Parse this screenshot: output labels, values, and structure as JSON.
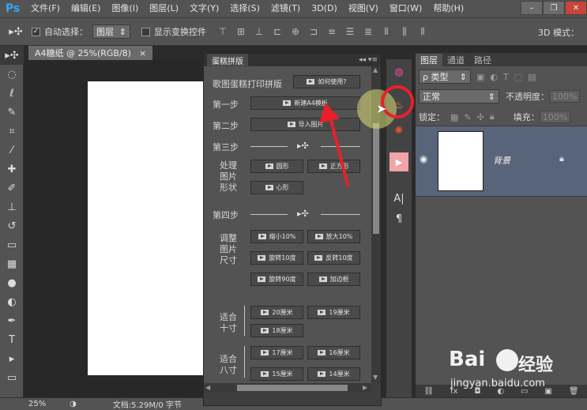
{
  "app": {
    "logo": "Ps",
    "menu": [
      "文件(F)",
      "编辑(E)",
      "图像(I)",
      "图层(L)",
      "文字(Y)",
      "选择(S)",
      "滤镜(T)",
      "3D(D)",
      "视图(V)",
      "窗口(W)",
      "帮助(H)"
    ],
    "window_controls": [
      "–",
      "❐",
      "✕"
    ]
  },
  "options_bar": {
    "auto_select_label": "自动选择：",
    "auto_select_value": "图层",
    "show_transform_label": "显示变换控件",
    "mode_3d_label": "3D 模式："
  },
  "document": {
    "tab_title": "A4糖纸 @ 25%(RGB/8)",
    "tab_close": "×"
  },
  "status": {
    "zoom": "25%",
    "doc_info": "文档:5.29M/0 字节"
  },
  "cake_panel": {
    "title": "蛋糕拼版",
    "header_controls": "◂◂ ▾≡",
    "intro_label": "歌图蛋糕打印拼版",
    "how_to_use": "如何使用?",
    "step1_label": "第一步",
    "new_a4": "新建A4模板",
    "step2_label": "第二步",
    "import_image": "导入图片",
    "step3_label": "第三步",
    "process_label_lines": [
      "处理",
      "图片",
      "形状"
    ],
    "btn_circle": "圆形",
    "btn_square": "正方形",
    "btn_heart": "心形",
    "step4_label": "第四步",
    "adjust_label_lines": [
      "调整",
      "图片",
      "尺寸"
    ],
    "btn_shrink": "缩小10%",
    "btn_enlarge": "放大10%",
    "btn_rotate": "旋转10度",
    "btn_rotate_rev": "反转10度",
    "btn_rotate90": "旋转90度",
    "btn_border": "加边框",
    "fit10_lines": [
      "适合",
      "十寸"
    ],
    "btn_20cm": "20厘米",
    "btn_19cm": "19厘米",
    "btn_18cm": "18厘米",
    "fit8_lines": [
      "适合",
      "八寸"
    ],
    "btn_17cm": "17厘米",
    "btn_16cm": "16厘米",
    "btn_15cm": "15厘米",
    "btn_14cm": "14厘米"
  },
  "layers_panel": {
    "tabs": [
      "图层",
      "通道",
      "路径"
    ],
    "filter_type": "ρ 类型",
    "blend_mode": "正常",
    "opacity_label": "不透明度：",
    "opacity_value": "100%",
    "lock_label": "锁定：",
    "fill_label": "填充：",
    "fill_value": "100%",
    "layer_name": "背景"
  },
  "watermark": {
    "brand": "Bai",
    "brand_suffix": "经验",
    "url": "jingyan.baidu.com"
  },
  "colors": {
    "accent_red": "#e8202a",
    "ps_blue": "#31a8ff",
    "layer_selected": "#58647a"
  }
}
